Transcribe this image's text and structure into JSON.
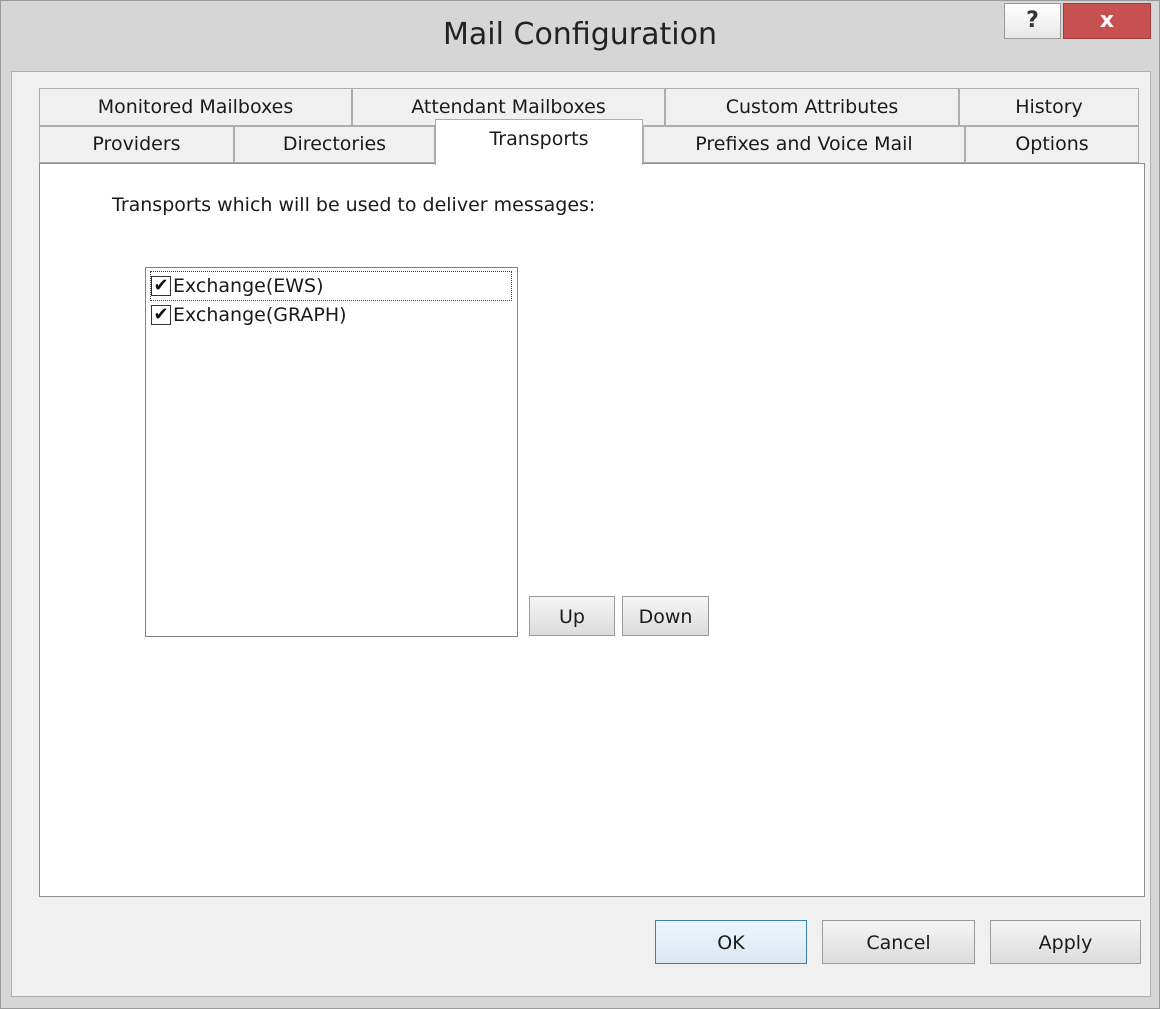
{
  "window": {
    "title": "Mail Configuration",
    "help_label": "?",
    "close_label": "x"
  },
  "tabs": {
    "row1": [
      {
        "label": "Monitored Mailboxes"
      },
      {
        "label": "Attendant Mailboxes"
      },
      {
        "label": "Custom Attributes"
      },
      {
        "label": "History"
      }
    ],
    "row2": [
      {
        "label": "Providers"
      },
      {
        "label": "Directories"
      },
      {
        "label": "Transports",
        "active": true
      },
      {
        "label": "Prefixes and Voice Mail"
      },
      {
        "label": "Options"
      }
    ]
  },
  "transports": {
    "description": "Transports which will be used to deliver messages:",
    "items": [
      {
        "label": "Exchange(EWS)",
        "checked": true,
        "check_mark": "✔"
      },
      {
        "label": "Exchange(GRAPH)",
        "checked": true,
        "check_mark": "✔"
      }
    ],
    "up_label": "Up",
    "down_label": "Down"
  },
  "footer": {
    "ok_label": "OK",
    "cancel_label": "Cancel",
    "apply_label": "Apply"
  },
  "colors": {
    "close_button": "#c75050",
    "window_frame": "#d6d6d6",
    "default_button_border": "#3c7fb1"
  }
}
